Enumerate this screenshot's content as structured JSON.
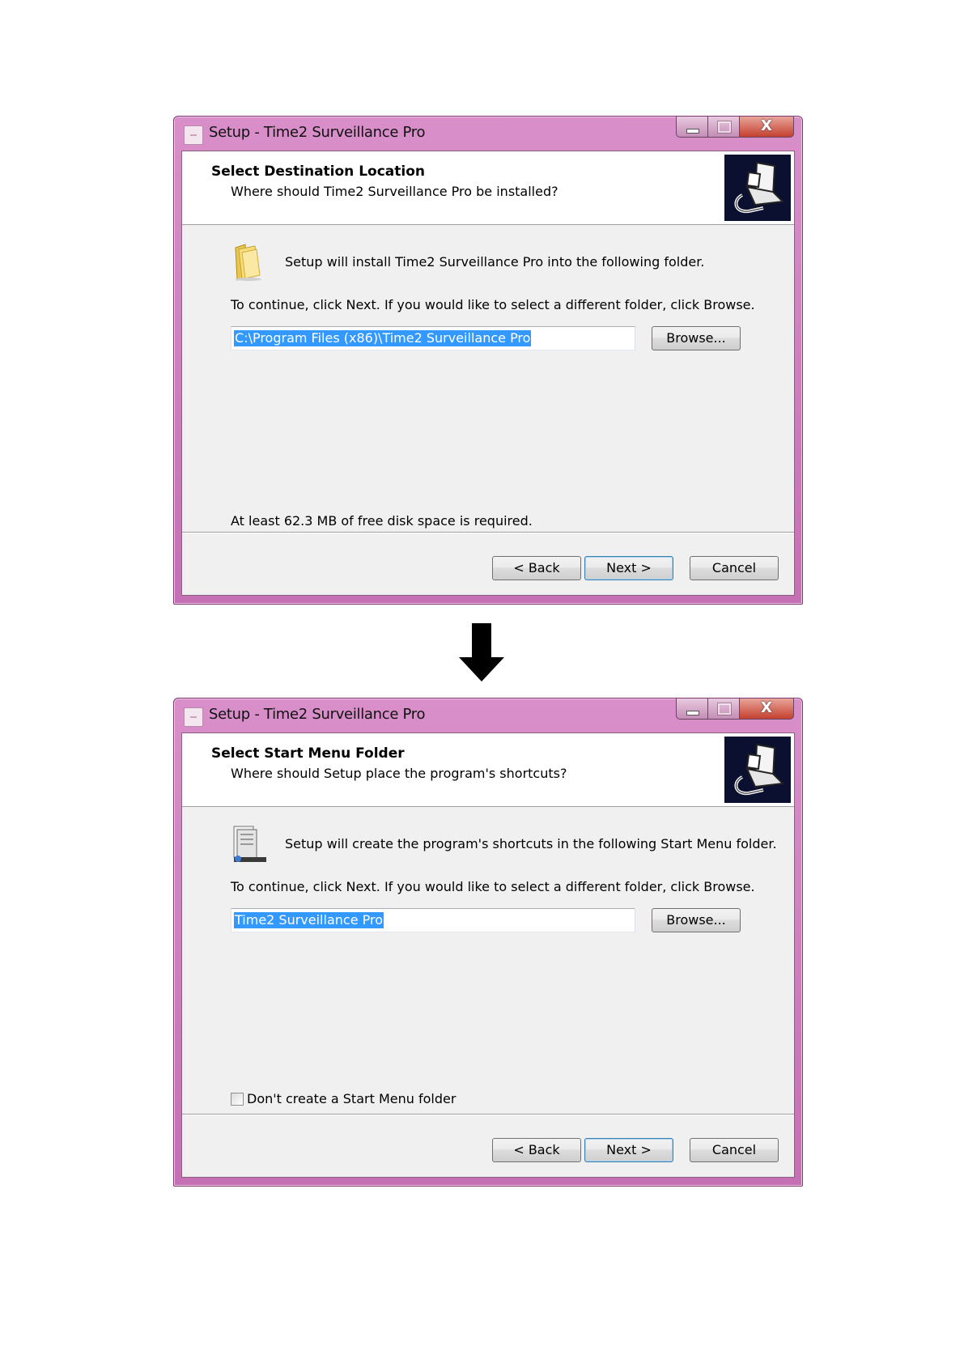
{
  "dialog1": {
    "title": "Setup - Time2 Surveillance Pro",
    "header_title": "Select Destination Location",
    "header_subtitle": "Where should Time2 Surveillance Pro be installed?",
    "intro": "Setup will install Time2 Surveillance Pro into the following folder.",
    "instruction": "To continue, click Next. If you would like to select a different folder, click Browse.",
    "path_value": "C:\\Program Files (x86)\\Time2 Surveillance Pro",
    "browse_label": "Browse...",
    "note": "At least 62.3 MB of free disk space is required.",
    "back_label": "< Back",
    "next_label": "Next >",
    "cancel_label": "Cancel",
    "close_glyph": "X"
  },
  "dialog2": {
    "title": "Setup - Time2 Surveillance Pro",
    "header_title": "Select Start Menu Folder",
    "header_subtitle": "Where should Setup place the program's shortcuts?",
    "intro": "Setup will create the program's shortcuts in the following Start Menu folder.",
    "instruction": "To continue, click Next. If you would like to select a different folder, click Browse.",
    "folder_value": "Time2 Surveillance Pro",
    "browse_label": "Browse...",
    "checkbox_label": "Don't create a Start Menu folder",
    "checkbox_checked": false,
    "back_label": "< Back",
    "next_label": "Next >",
    "cancel_label": "Cancel",
    "close_glyph": "X"
  },
  "icons": {
    "folder": "folder-icon",
    "start_menu": "start-menu-folder-icon",
    "wizard_logo": "computer-install-logo",
    "arrow": "down-arrow-icon"
  },
  "colors": {
    "title_bar": "#c97fbb",
    "selection": "#3399ff",
    "default_button_border": "#3c7fb1"
  }
}
